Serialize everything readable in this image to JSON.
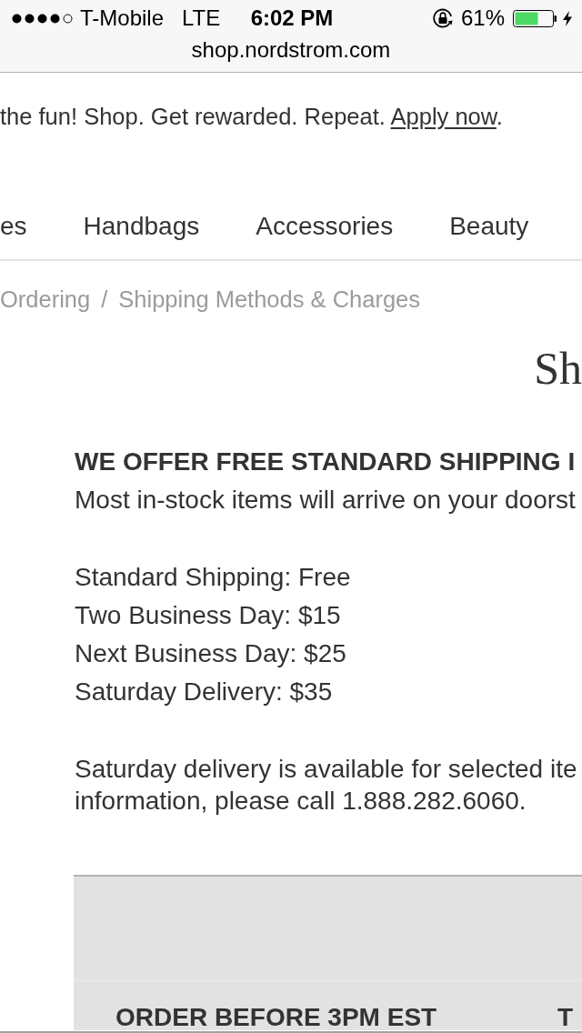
{
  "status_bar": {
    "carrier": "T-Mobile",
    "network": "LTE",
    "time": "6:02 PM",
    "battery": "61%"
  },
  "address_bar": {
    "url": "shop.nordstrom.com"
  },
  "promo_banner": {
    "text": "the fun! Shop. Get rewarded. Repeat.",
    "link": "Apply now",
    "text_after": "."
  },
  "nav": {
    "items": [
      "es",
      "Handbags",
      "Accessories",
      "Beauty"
    ]
  },
  "breadcrumb": {
    "items": [
      "Ordering",
      "Shipping Methods & Charges"
    ],
    "separator": "/"
  },
  "page_title": "Sh",
  "intro": {
    "heading": "WE OFFER FREE STANDARD SHIPPING I",
    "text": "Most in-stock items will arrive on your doorst"
  },
  "shipping_options": [
    "Standard Shipping: Free",
    "Two Business Day: $15",
    "Next Business Day: $25",
    "Saturday Delivery: $35"
  ],
  "note": {
    "lines": [
      "Saturday delivery is available for selected ite",
      "information, please call 1.888.282.6060."
    ]
  },
  "table": {
    "rows": [
      {
        "cells": [
          "ORDER BEFORE 3PM EST",
          "T"
        ]
      }
    ]
  }
}
